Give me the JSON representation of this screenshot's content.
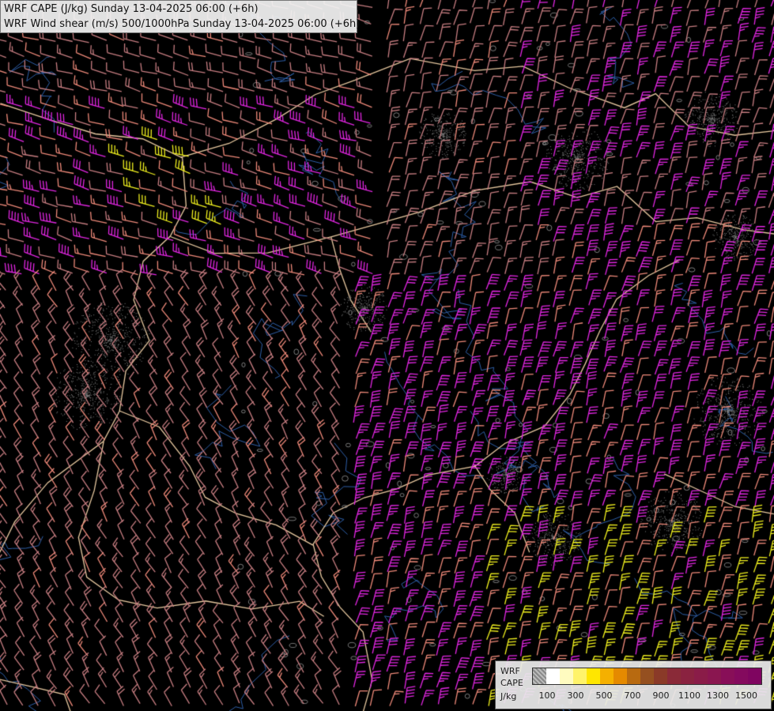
{
  "header": {
    "line1": "WRF CAPE (J/kg) Sunday 13-04-2025 06:00 (+6h)",
    "line2": "WRF Wind shear (m/s) 500/1000hPa Sunday 13-04-2025 06:00 (+6h)"
  },
  "legend": {
    "label_model": "WRF",
    "label_var": "CAPE",
    "label_unit": "J/kg",
    "tick_labels": [
      "100",
      "300",
      "500",
      "700",
      "900",
      "1100",
      "1300",
      "1500"
    ],
    "colors": [
      "#9a9a9a",
      "#ffffff",
      "#fffbc0",
      "#fff36a",
      "#ffe600",
      "#f5b000",
      "#e58a00",
      "#b86a10",
      "#955020",
      "#8a3a28",
      "#8a2a38",
      "#8a2240",
      "#8a1c48",
      "#8a1650",
      "#880f58",
      "#840a5e",
      "#7f0560"
    ]
  },
  "map": {
    "background": "#000000",
    "border_color": "#e8c9a0",
    "river_color": "#2e5fa8",
    "barb_colors": {
      "low": "#c87e82",
      "mid": "#f08a7a",
      "high": "#e326e3",
      "max": "#f2f21f"
    }
  }
}
